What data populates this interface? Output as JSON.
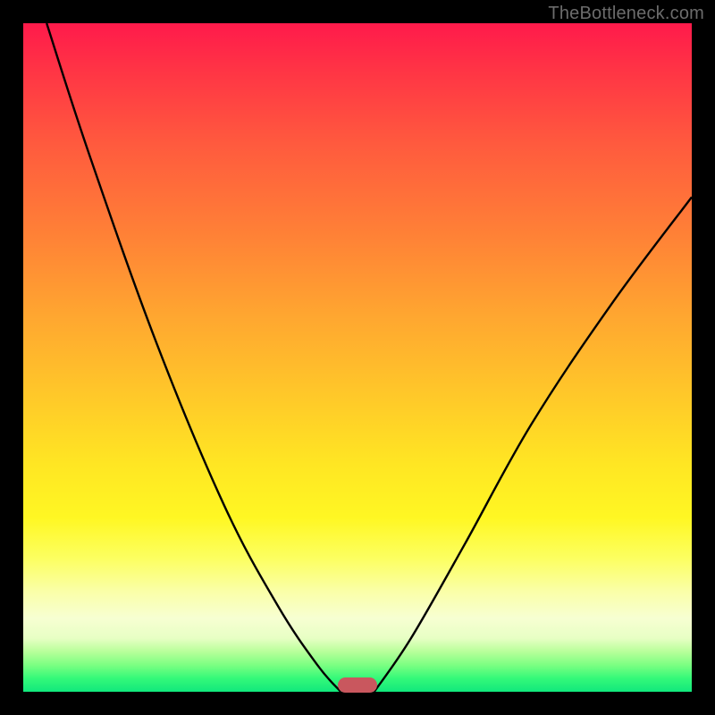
{
  "watermark": "TheBottleneck.com",
  "chart_data": {
    "type": "line",
    "title": "",
    "xlabel": "",
    "ylabel": "",
    "xlim": [
      0,
      100
    ],
    "ylim": [
      0,
      100
    ],
    "background_gradient": {
      "top_color": "#ff1a4b",
      "mid_color": "#ffe623",
      "bottom_color": "#11e87c"
    },
    "series": [
      {
        "name": "left_curve",
        "x": [
          3.5,
          10,
          20,
          30,
          38,
          44,
          47.5
        ],
        "y": [
          100,
          80,
          52,
          28,
          13,
          4,
          0
        ]
      },
      {
        "name": "right_curve",
        "x": [
          52.5,
          58,
          66,
          76,
          88,
          100
        ],
        "y": [
          0,
          8,
          22,
          40,
          58,
          74
        ]
      }
    ],
    "optimal_marker": {
      "x_start": 47,
      "x_end": 53,
      "y": 0,
      "color": "#c9575e"
    }
  }
}
